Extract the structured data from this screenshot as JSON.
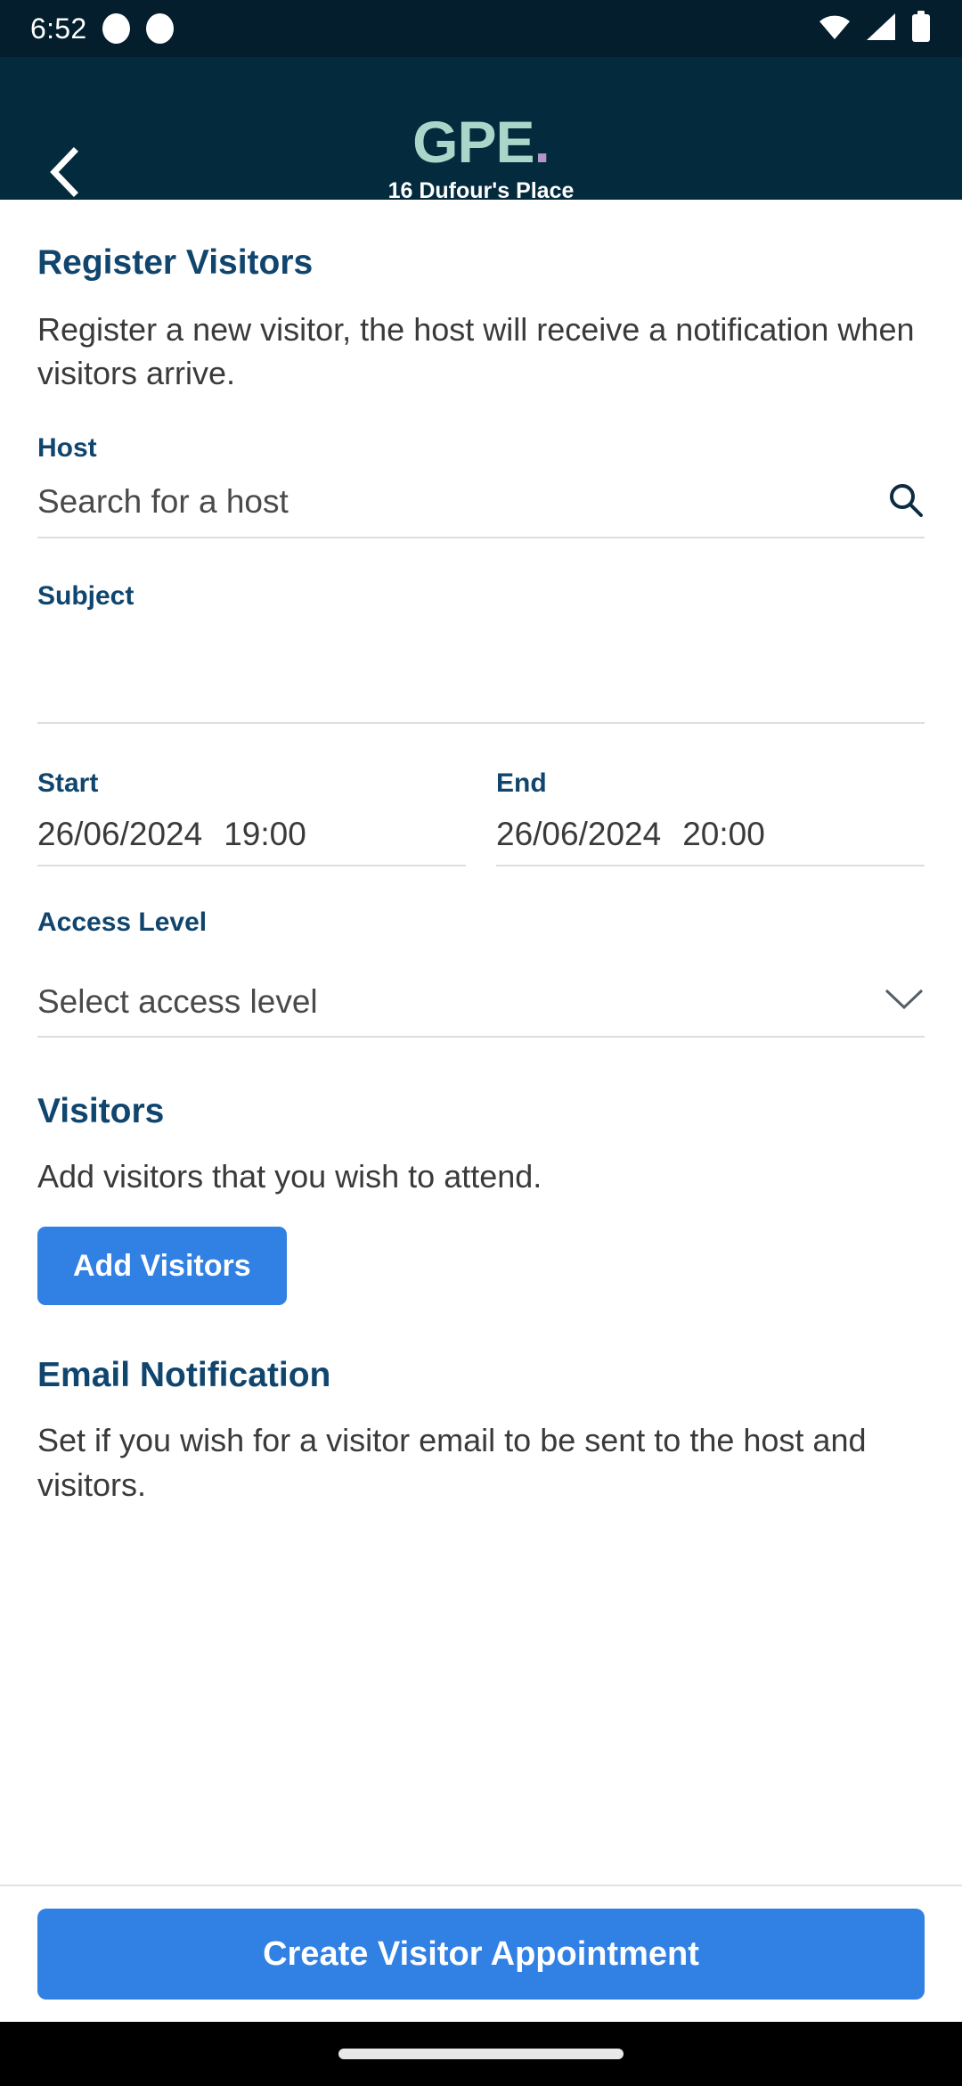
{
  "status_bar": {
    "time": "6:52",
    "notification_dots": 2,
    "icons": [
      "wifi-icon",
      "cellular-signal-icon",
      "battery-icon"
    ]
  },
  "header": {
    "back_icon": "chevron-left-icon",
    "brand": "GPE",
    "brand_dot": ".",
    "site_name": "16 Dufour's Place",
    "bg_color": "#042A3E",
    "brand_color": "#A9D6C9",
    "dot_color": "#B295C9"
  },
  "intro": {
    "title": "Register Visitors",
    "description": "Register a new visitor, the host will receive a notification when visitors arrive."
  },
  "host": {
    "label": "Host",
    "placeholder": "Search for a host",
    "value": "",
    "search_icon": "search-icon"
  },
  "subject": {
    "label": "Subject",
    "placeholder": "",
    "value": ""
  },
  "start": {
    "label": "Start",
    "date": "26/06/2024",
    "time": "19:00"
  },
  "end": {
    "label": "End",
    "date": "26/06/2024",
    "time": "20:00"
  },
  "access_level": {
    "label": "Access Level",
    "placeholder": "Select access level",
    "value": "",
    "chevron_icon": "chevron-down-icon"
  },
  "visitors": {
    "title": "Visitors",
    "description": "Add visitors that you wish to attend.",
    "add_button_label": "Add Visitors"
  },
  "email_notification": {
    "title": "Email Notification",
    "description": "Set if you wish for a visitor email to be sent to the host and visitors."
  },
  "footer": {
    "submit_label": "Create Visitor Appointment",
    "accent_color": "#3180E3"
  }
}
